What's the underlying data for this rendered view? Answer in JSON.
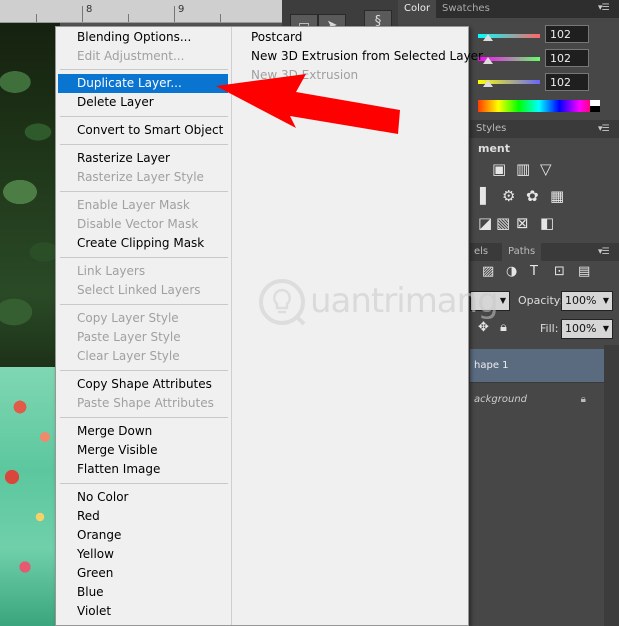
{
  "ruler": {
    "mark_8": "8",
    "mark_9": "9"
  },
  "context_menu": {
    "items": [
      {
        "label": "Blending Options...",
        "enabled": true
      },
      {
        "label": "Edit Adjustment...",
        "enabled": false
      },
      {
        "label": "Duplicate Layer...",
        "enabled": true,
        "highlighted": true
      },
      {
        "label": "Delete Layer",
        "enabled": true
      },
      {
        "label": "Convert to Smart Object",
        "enabled": true
      },
      {
        "label": "Rasterize Layer",
        "enabled": true
      },
      {
        "label": "Rasterize Layer Style",
        "enabled": false
      },
      {
        "label": "Enable Layer Mask",
        "enabled": false
      },
      {
        "label": "Disable Vector Mask",
        "enabled": false
      },
      {
        "label": "Create Clipping Mask",
        "enabled": true
      },
      {
        "label": "Link Layers",
        "enabled": false
      },
      {
        "label": "Select Linked Layers",
        "enabled": false
      },
      {
        "label": "Copy Layer Style",
        "enabled": false
      },
      {
        "label": "Paste Layer Style",
        "enabled": false
      },
      {
        "label": "Clear Layer Style",
        "enabled": false
      },
      {
        "label": "Copy Shape Attributes",
        "enabled": true
      },
      {
        "label": "Paste Shape Attributes",
        "enabled": false
      },
      {
        "label": "Merge Down",
        "enabled": true
      },
      {
        "label": "Merge Visible",
        "enabled": true
      },
      {
        "label": "Flatten Image",
        "enabled": true
      },
      {
        "label": "No Color",
        "enabled": true
      },
      {
        "label": "Red",
        "enabled": true
      },
      {
        "label": "Orange",
        "enabled": true
      },
      {
        "label": "Yellow",
        "enabled": true
      },
      {
        "label": "Green",
        "enabled": true
      },
      {
        "label": "Blue",
        "enabled": true
      },
      {
        "label": "Violet",
        "enabled": true
      }
    ],
    "right_items": [
      {
        "label": "Postcard",
        "enabled": true
      },
      {
        "label": "New 3D Extrusion from Selected Layer",
        "enabled": true
      },
      {
        "label": "New 3D Extrusion",
        "enabled": false
      }
    ]
  },
  "color_panel": {
    "tab_color": "Color",
    "tab_swatches": "Swatches",
    "r_value": "102",
    "g_value": "102",
    "b_value": "102"
  },
  "styles_panel": {
    "tab_styles": "Styles",
    "adjustments_label": "ment"
  },
  "layers_panel": {
    "tab_layers": "els",
    "tab_paths": "Paths",
    "opacity_label": "Opacity:",
    "opacity_value": "100%",
    "fill_label": "Fill:",
    "fill_value": "100%",
    "layers": [
      {
        "name": "hape 1",
        "selected": true
      },
      {
        "name": "ackground",
        "selected": false
      }
    ]
  },
  "watermark": {
    "text": "uantrimang"
  },
  "colors": {
    "highlight": "#0a74d1",
    "arrow": "#ff0000",
    "menu_bg": "#f0f0f0",
    "panel_bg": "#474747"
  }
}
